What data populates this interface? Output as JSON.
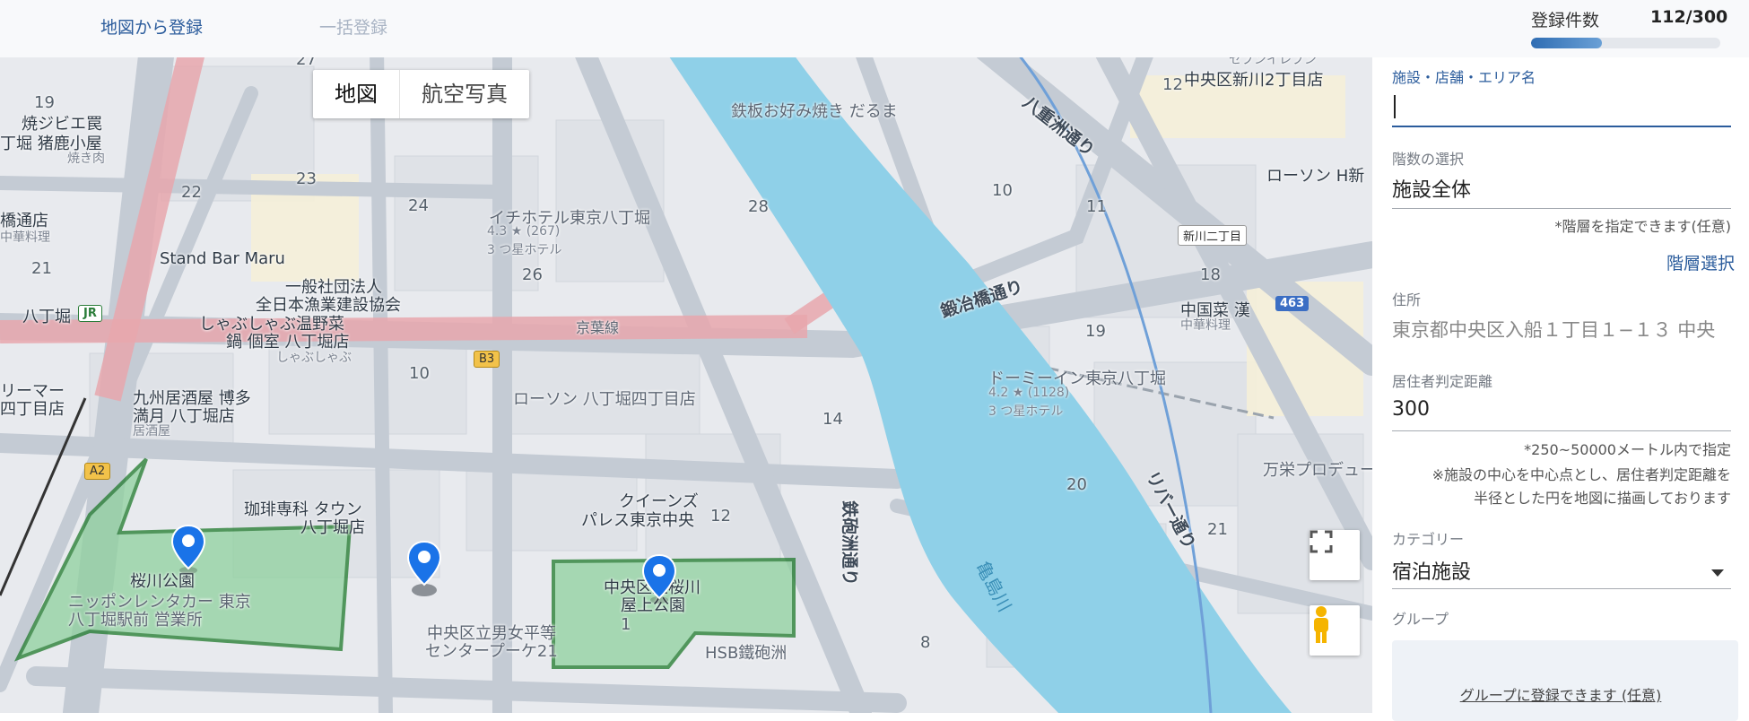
{
  "tabs": {
    "register_from_map": "地図から登録",
    "bulk_register": "一括登録"
  },
  "counter": {
    "label": "登録件数",
    "value": "112/300",
    "progress": 0.373
  },
  "map": {
    "type_map": "地図",
    "type_satellite": "航空写真",
    "labels": {
      "yakitori": "焼ジビエ罠",
      "inoshika": "丁堀 猪鹿小屋",
      "yakiniku": "焼き肉",
      "hatchobori_station": "八丁堀",
      "hacchobori_kyobashi": "八丁堀",
      "kyobashi": "橋通店",
      "chuka": "中華料理",
      "stand_bar": "Stand Bar Maru",
      "kyodo": "一般社団法人",
      "gyogyo": "全日本漁業建設協会",
      "shabushabu": "しゃぶしゃぶ温野菜",
      "shabushabu2": "鍋 個室 八丁堀店",
      "shabushabu3": "しゃぶしゃぶ",
      "ichi_hotel": "イチホテル東京八丁堀",
      "ichi_rating": "4.3 ★ (267)",
      "ichi_class": "3 つ星ホテル",
      "teppan": "鉄板お好み焼き だるま",
      "keiyo": "京葉線",
      "lawson": "ローソン 八丁堀四丁目店",
      "kyushu": "九州居酒屋 博多",
      "kyushu2": "満月 八丁堀店",
      "izakaya": "居酒屋",
      "remar": "リーマー",
      "yonchome": "四丁目店",
      "coffee": "珈琲専科 タウン",
      "coffee2": "八丁堀店",
      "sakuragawa_park": "桜川公園",
      "nippon_rent": "ニッポンレンタカー 東京",
      "nippon_rent2": "八丁堀駅前 営業所",
      "danjo": "中央区立男女平等",
      "center": "センタープーケ21",
      "queens": "クイーンズ",
      "palace": "パレス東京中央",
      "chuo_park": "中央区立桜川",
      "okujo": "屋上公園",
      "hsb": "HSB鐵砲洲",
      "teppozu_dori": "鉄砲洲通り",
      "kameshima": "亀島川",
      "yaesu_dori": "八重洲通り",
      "kajibashi": "鍛冶橋通り",
      "river_dori": "リバー通り",
      "shinkawa": "中央区新川2丁目店",
      "lawson_h": "ローソン H新",
      "shinkawa_2": "新川二丁目",
      "dormy": "ドーミーイン東京八丁堀",
      "dormy_rating": "4.2 ★ (1128)",
      "dormy_class": "3 つ星ホテル",
      "chuka_kan": "中国菜 漢",
      "chuka_kan2": "中華料理",
      "manei": "万栄プロデュー",
      "rt_463": "463",
      "b3": "B3",
      "a2": "A2",
      "jr": "JR",
      "seven": "セブンイレブン",
      "num_19": "19",
      "num_21": "21",
      "num_22": "22",
      "num_23": "23",
      "num_24": "24",
      "num_26": "26",
      "num_28": "28",
      "num_10": "10",
      "num_14": "14",
      "num_12": "12",
      "num_1": "1",
      "num_8": "8",
      "num_10b": "10",
      "num_11": "11",
      "num_18": "18",
      "num_19b": "19",
      "num_20": "20",
      "num_21b": "21",
      "num_12b": "12",
      "num_27": "27"
    }
  },
  "form": {
    "facility_label": "施設・店舗・エリア名",
    "facility_value": "",
    "floor_label": "階数の選択",
    "floor_value": "施設全体",
    "floor_note": "*階層を指定できます(任意)",
    "floor_link": "階層選択",
    "address_label": "住所",
    "address_value": "東京都中央区入船１丁目１−１３ 中央",
    "distance_label": "居住者判定距離",
    "distance_value": "300",
    "distance_note1": "*250~50000メートル内で指定",
    "distance_note2": "※施設の中心を中心点とし、居住者判定距離を",
    "distance_note3": "半径とした円を地図に描画しております",
    "category_label": "カテゴリー",
    "category_value": "宿泊施設",
    "group_label": "グループ",
    "group_link": "グループに登録できます (任意)"
  },
  "colors": {
    "accent": "#2b5c9c",
    "river": "#8fd0e8",
    "park": "#8fd19e",
    "park_border": "#1f7a2c",
    "marker": "#1a73e8"
  }
}
